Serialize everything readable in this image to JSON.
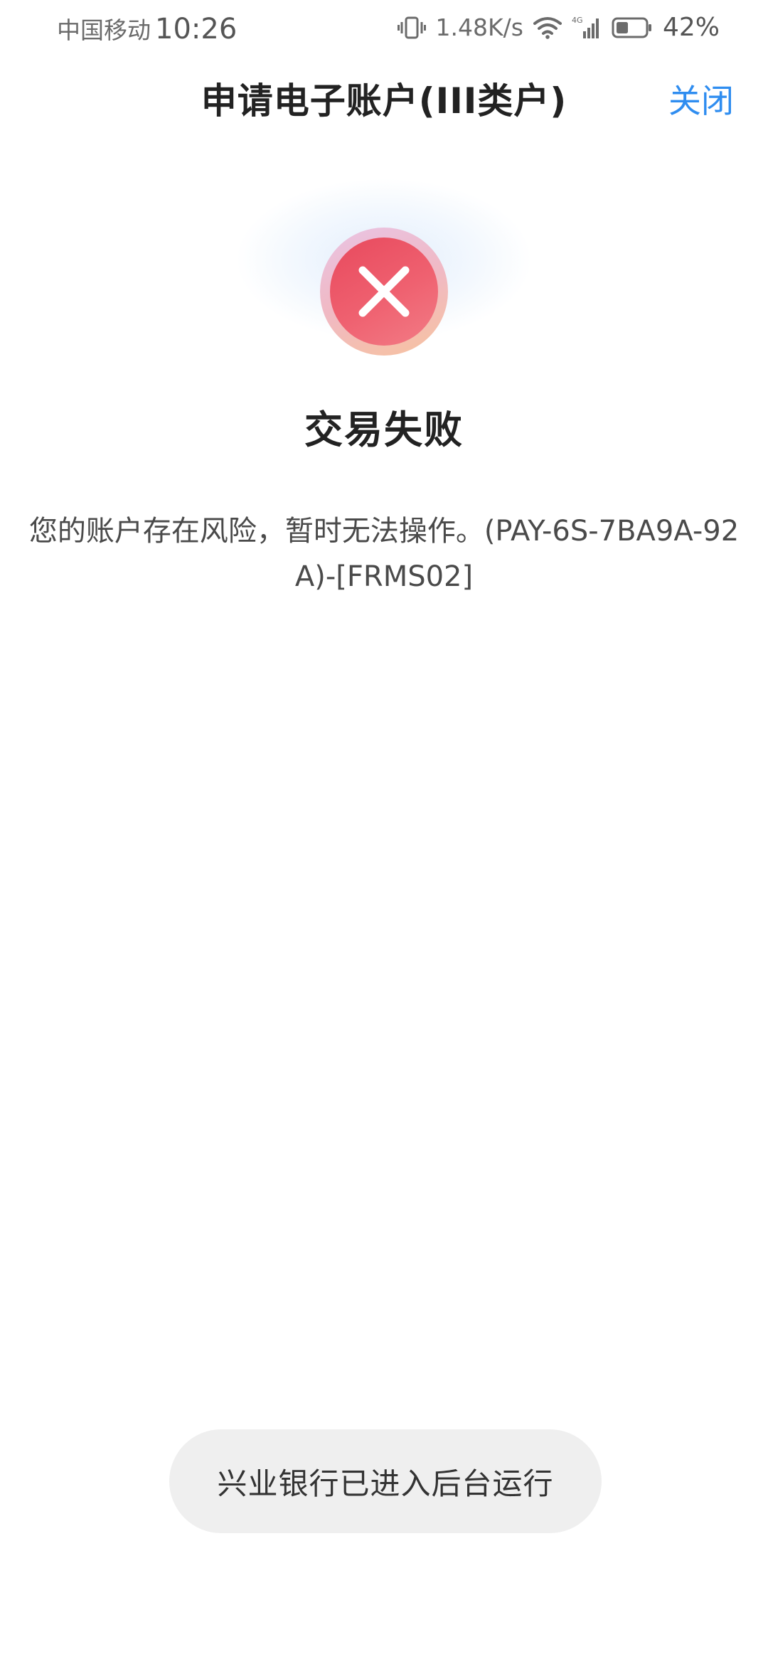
{
  "status_bar": {
    "carrier": "中国移动",
    "time": "10:26",
    "net_speed": "1.48K/s",
    "network_type": "4G",
    "battery_percent": "42%",
    "battery_level": 0.42,
    "icons": [
      "vibrate-icon",
      "wifi-icon",
      "signal-icon",
      "battery-icon"
    ]
  },
  "nav": {
    "title": "申请电子账户(III类户)",
    "close_label": "关闭",
    "close_color": "#2f8df0"
  },
  "result": {
    "status_icon": "close-icon",
    "status_color": "#e8495d",
    "title": "交易失败",
    "message": "您的账户存在风险，暂时无法操作。(PAY-6S-7BA9A-92A)-[FRMS02]"
  },
  "toast": {
    "text": "兴业银行已进入后台运行"
  }
}
